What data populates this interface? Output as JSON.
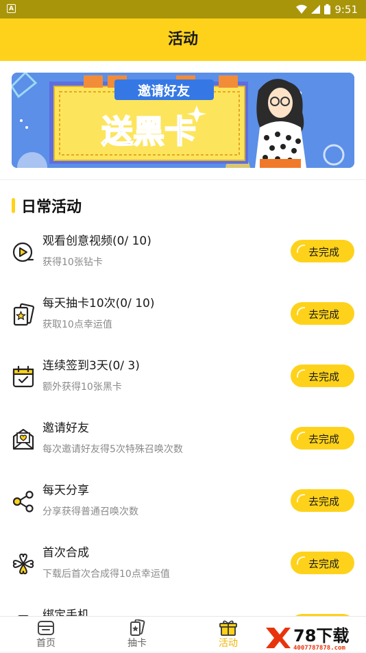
{
  "status_bar": {
    "time": "9:51"
  },
  "header": {
    "title": "活动"
  },
  "banner": {
    "heading": "邀请好友",
    "main_text": "送黑卡"
  },
  "section": {
    "title": "日常活动",
    "tasks": [
      {
        "icon": "play-icon",
        "title": "观看创意视频(0/ 10)",
        "desc": "获得10张钻卡",
        "button": "去完成"
      },
      {
        "icon": "card-draw-icon",
        "title": "每天抽卡10次(0/ 10)",
        "desc": "获取10点幸运值",
        "button": "去完成"
      },
      {
        "icon": "calendar-check-icon",
        "title": "连续签到3天(0/ 3)",
        "desc": "额外获得10张黑卡",
        "button": "去完成"
      },
      {
        "icon": "invite-envelope-icon",
        "title": "邀请好友",
        "desc": "每次邀请好友得5次特殊召唤次数",
        "button": "去完成"
      },
      {
        "icon": "share-icon",
        "title": "每天分享",
        "desc": "分享获得普通召唤次数",
        "button": "去完成"
      },
      {
        "icon": "clover-icon",
        "title": "首次合成",
        "desc": "下载后首次合成得10点幸运值",
        "button": "去完成"
      },
      {
        "icon": "phone-icon",
        "title": "绑定手机"
      }
    ]
  },
  "tabbar": {
    "items": [
      {
        "label": "首页",
        "icon": "home-icon"
      },
      {
        "label": "抽卡",
        "icon": "card-icon"
      },
      {
        "label": "活动",
        "icon": "gift-icon",
        "active": true
      }
    ]
  },
  "watermark": {
    "text": "78下载",
    "url": "4007787878.com"
  },
  "colors": {
    "accent": "#fed21a",
    "status_bar": "#a9950a"
  }
}
